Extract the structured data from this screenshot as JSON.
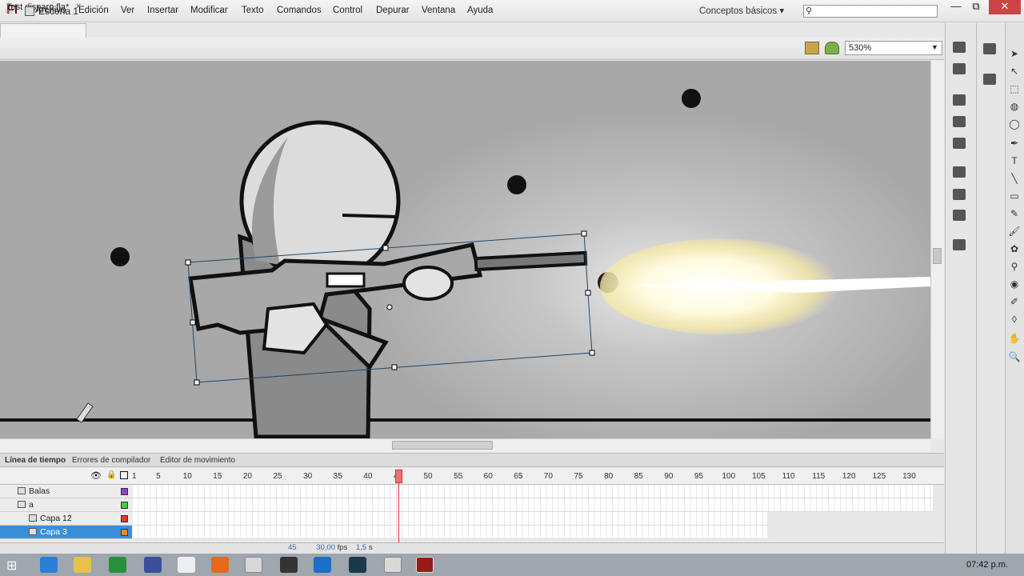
{
  "app": {
    "logo": "Fl",
    "workspace": "Conceptos básicos ▾",
    "menu": [
      "Archivo",
      "Edición",
      "Ver",
      "Insertar",
      "Modificar",
      "Texto",
      "Comandos",
      "Control",
      "Depurar",
      "Ventana",
      "Ayuda"
    ],
    "window_controls": [
      "—",
      "⧉",
      "✕"
    ]
  },
  "document": {
    "tab_label": "Test disparo.fla*",
    "tab_close": "×"
  },
  "editbar": {
    "scene": "Escena 1",
    "zoom": "530%"
  },
  "timeline": {
    "tabs": [
      "Línea de tiempo",
      "Errores de compilador",
      "Editor de movimiento"
    ],
    "frame_numbers": [
      "1",
      "5",
      "10",
      "15",
      "20",
      "25",
      "30",
      "35",
      "40",
      "45",
      "50",
      "55",
      "60",
      "65",
      "70",
      "75",
      "80",
      "85",
      "90",
      "95",
      "100",
      "105",
      "110",
      "115",
      "120",
      "125",
      "130"
    ],
    "layers": [
      {
        "name": "Balas",
        "indent": 0
      },
      {
        "name": "a",
        "indent": 0
      },
      {
        "name": "Capa 12",
        "indent": 1
      },
      {
        "name": "Capa 3",
        "indent": 1
      }
    ],
    "current_frame": "45",
    "fps": "30,00",
    "fps_unit": "fps",
    "time": "1,5",
    "time_unit": "s"
  },
  "taskbar": {
    "clock": "07:42 p.m."
  },
  "colors": {
    "accent_red": "#e33333",
    "layer_selected": "#3b8fd9"
  }
}
